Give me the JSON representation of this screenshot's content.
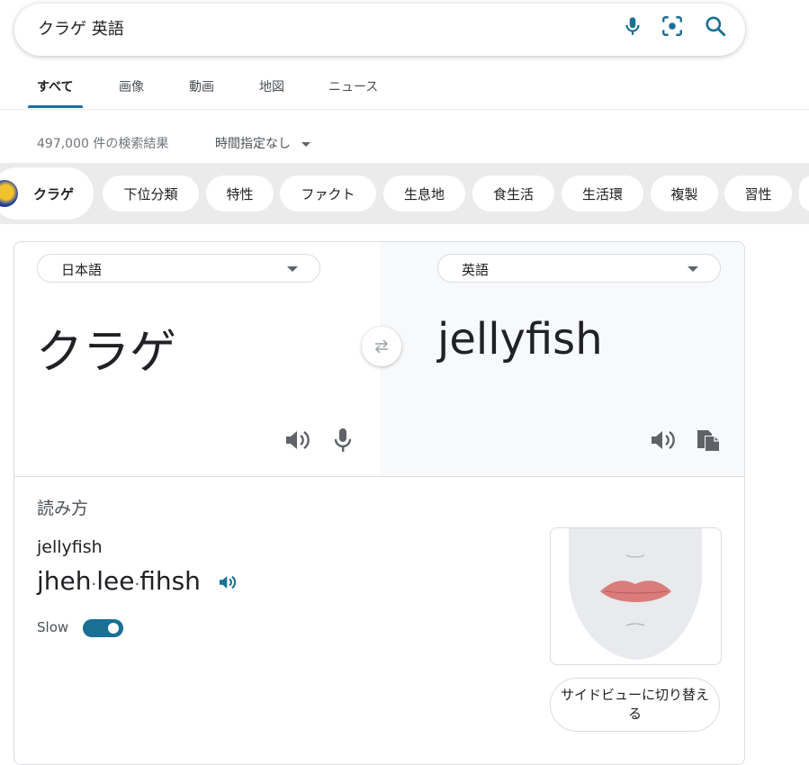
{
  "search": {
    "query": "クラゲ 英語"
  },
  "tabs": [
    {
      "label": "すべて",
      "active": true
    },
    {
      "label": "画像"
    },
    {
      "label": "動画"
    },
    {
      "label": "地図"
    },
    {
      "label": "ニュース"
    }
  ],
  "results": {
    "count_text": "497,000 件の検索結果",
    "time_filter": "時間指定なし"
  },
  "chips": {
    "main": "クラゲ",
    "items": [
      "下位分類",
      "特性",
      "ファクト",
      "生息地",
      "食生活",
      "生活環",
      "複製",
      "習性"
    ]
  },
  "translate": {
    "source_lang": "日本語",
    "target_lang": "英語",
    "source_text": "クラゲ",
    "target_text": "jellyfish"
  },
  "pronunciation": {
    "title": "読み方",
    "word": "jellyfish",
    "syllables": [
      "jheh",
      "lee",
      "fihsh"
    ],
    "slow_label": "Slow",
    "slow_on": true,
    "side_view_label": "サイドビューに切り替える"
  },
  "colors": {
    "accent": "#1a6f94",
    "chip_strip": "#ebebeb",
    "lips": "#d97c7a"
  },
  "icons": [
    "microphone-icon",
    "lens-icon",
    "search-icon",
    "swap-icon",
    "speaker-icon",
    "copy-icon"
  ]
}
